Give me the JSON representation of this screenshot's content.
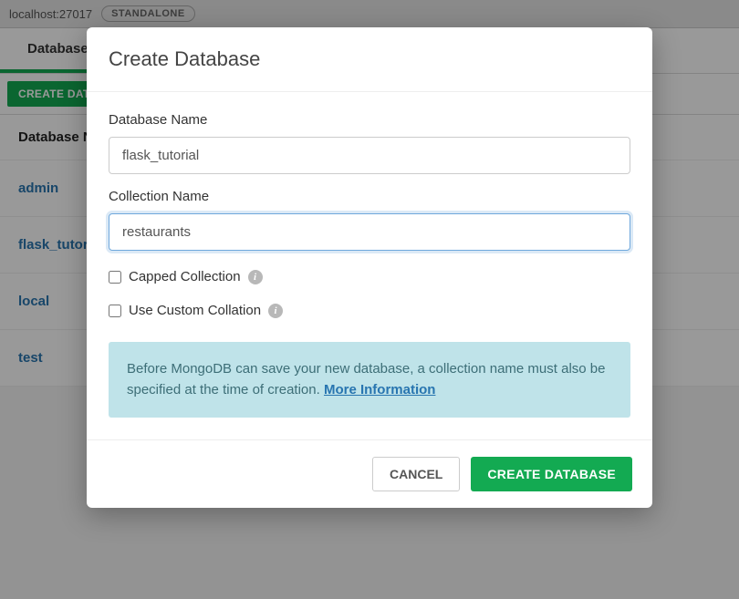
{
  "topbar": {
    "host": "localhost:27017",
    "mode": "STANDALONE"
  },
  "tabs": {
    "databases_label": "Databases"
  },
  "actions": {
    "create_db_label": "CREATE DATABASE"
  },
  "table": {
    "header_name": "Database Name"
  },
  "databases": [
    {
      "name": "admin"
    },
    {
      "name": "flask_tutorial"
    },
    {
      "name": "local"
    },
    {
      "name": "test"
    }
  ],
  "modal": {
    "title": "Create Database",
    "db_name_label": "Database Name",
    "db_name_value": "flask_tutorial",
    "coll_name_label": "Collection Name",
    "coll_name_value": "restaurants",
    "capped_label": "Capped Collection",
    "collation_label": "Use Custom Collation",
    "info_text": "Before MongoDB can save your new database, a collection name must also be specified at the time of creation.",
    "info_link_label": "More Information",
    "cancel_label": "CANCEL",
    "submit_label": "CREATE DATABASE",
    "info_glyph": "i"
  }
}
